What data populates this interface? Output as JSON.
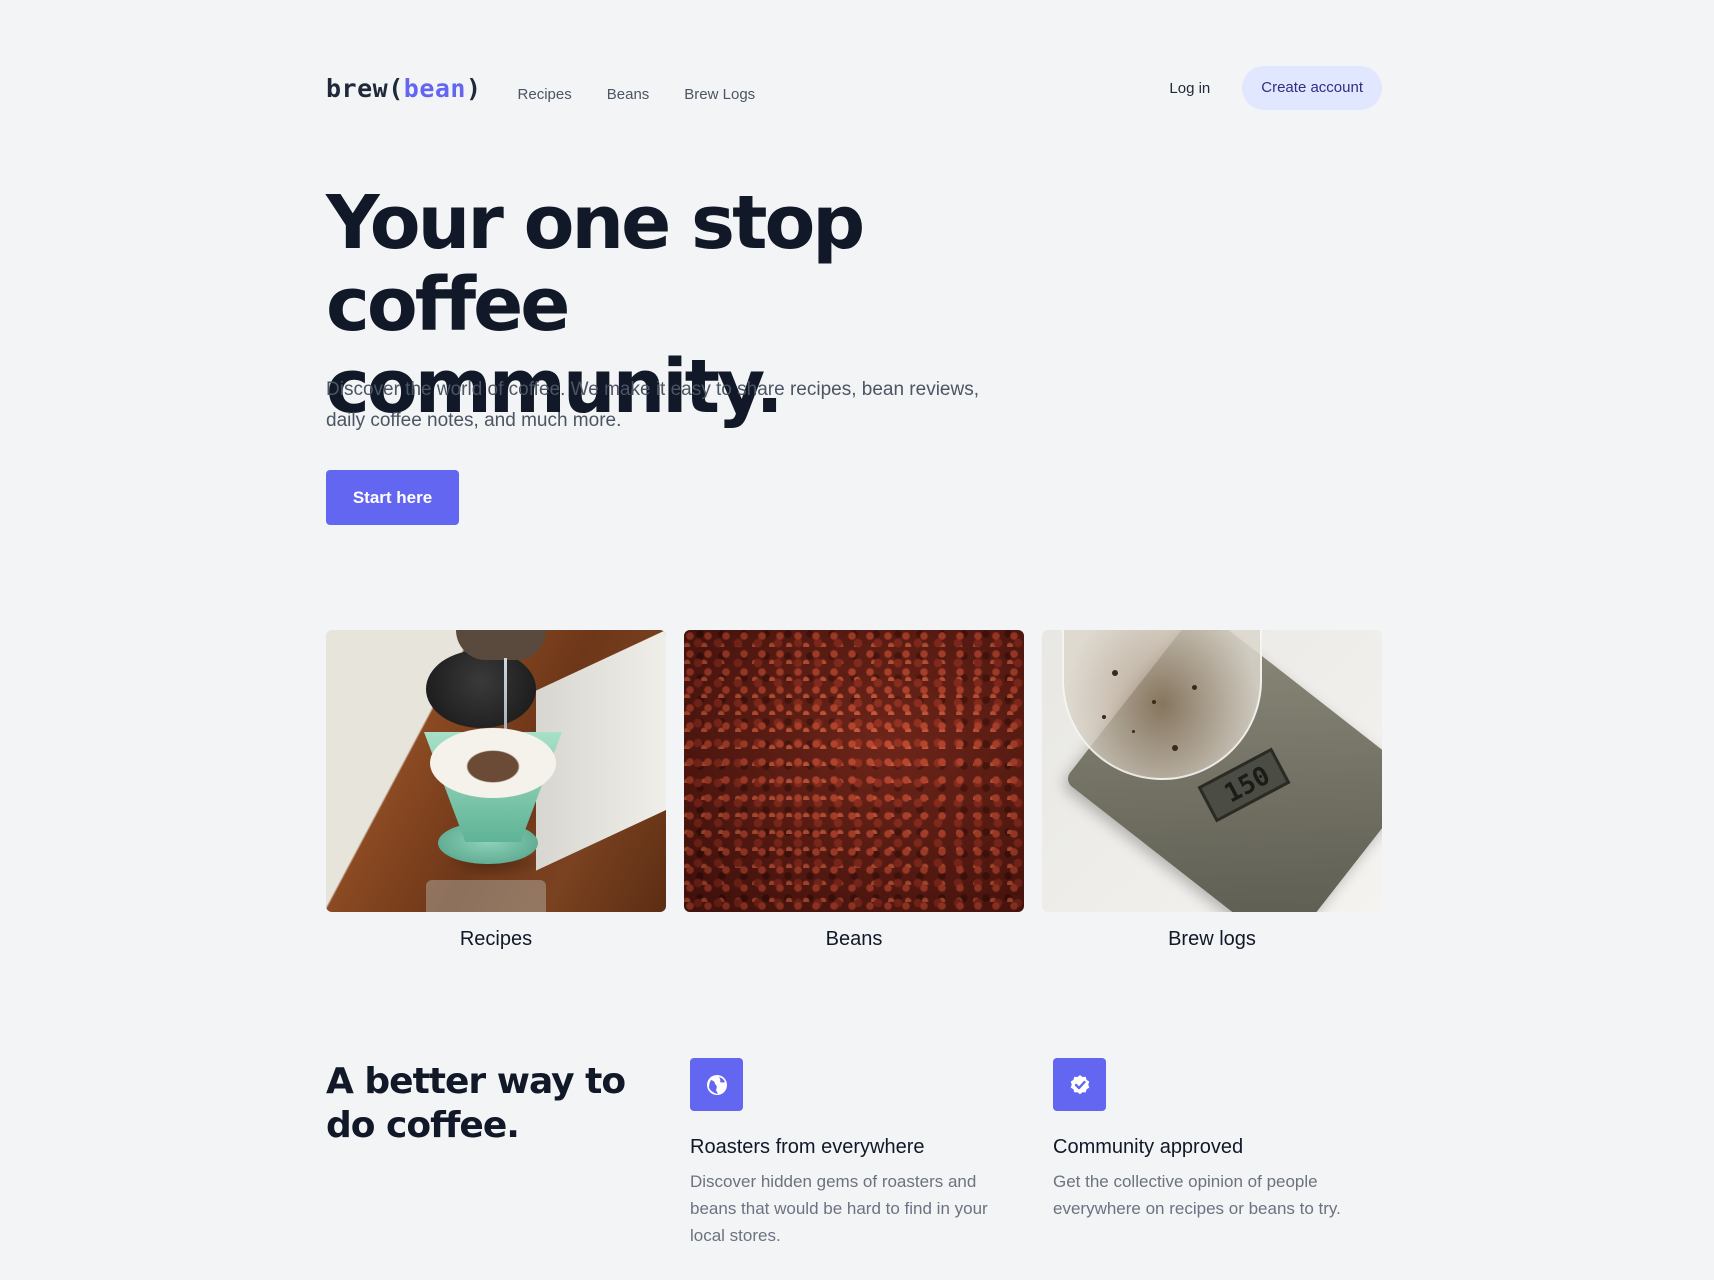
{
  "header": {
    "logo_prefix": "brew(",
    "logo_accent": "bean",
    "logo_suffix": ")",
    "nav": [
      "Recipes",
      "Beans",
      "Brew Logs"
    ],
    "login_label": "Log in",
    "create_account_label": "Create account"
  },
  "hero": {
    "title_line1": "Your one stop coffee",
    "title_line2": "community.",
    "description": "Discover the world of coffee. We make it easy to share recipes, bean reviews, daily coffee notes, and much more.",
    "cta_label": "Start here"
  },
  "cards": [
    {
      "label": "Recipes"
    },
    {
      "label": "Beans"
    },
    {
      "label": "Brew logs"
    }
  ],
  "brew_scale_reading": "150",
  "features": {
    "title_line1": "A better way to",
    "title_line2": "do coffee.",
    "items": [
      {
        "icon": "globe-icon",
        "heading": "Roasters from everywhere",
        "text": "Discover hidden gems of roasters and beans that would be hard to find in your local stores."
      },
      {
        "icon": "badge-check-icon",
        "heading": "Community approved",
        "text": "Get the collective opinion of people everywhere on recipes or beans to try."
      }
    ]
  },
  "colors": {
    "accent": "#6366f1",
    "background": "#f3f4f6",
    "text_primary": "#111827",
    "text_secondary": "#6b7280"
  }
}
